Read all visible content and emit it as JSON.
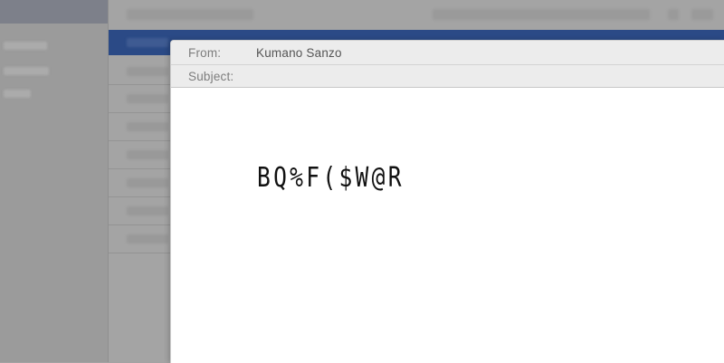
{
  "compose": {
    "from_label": "From:",
    "from_value": "Kumano Sanzo",
    "subject_label": "Subject:",
    "subject_value": "",
    "body_text": "BQ%F($W@R"
  },
  "colors": {
    "selected_row": "#2b4a86",
    "header_background": "#ececec",
    "body_background": "#ffffff"
  }
}
